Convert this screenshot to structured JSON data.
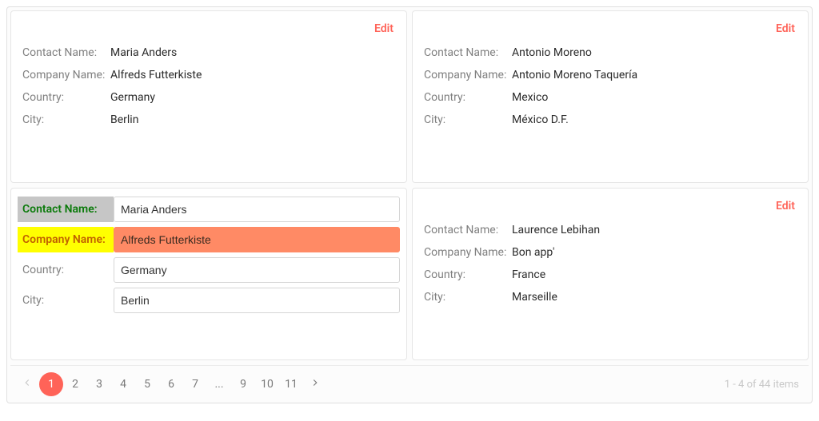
{
  "labels": {
    "edit": "Edit",
    "contactName": "Contact Name:",
    "companyName": "Company Name:",
    "country": "Country:",
    "city": "City:"
  },
  "cards": [
    {
      "contactName": "Maria Anders",
      "companyName": "Alfreds Futterkiste",
      "country": "Germany",
      "city": "Berlin"
    },
    {
      "contactName": "Antonio Moreno",
      "companyName": "Antonio Moreno Taquería",
      "country": "Mexico",
      "city": "México D.F."
    },
    {
      "contactName": "Maria Anders",
      "companyName": "Alfreds Futterkiste",
      "country": "Germany",
      "city": "Berlin"
    },
    {
      "contactName": "Laurence Lebihan",
      "companyName": "Bon app'",
      "country": "France",
      "city": "Marseille"
    }
  ],
  "pager": {
    "pages": [
      "1",
      "2",
      "3",
      "4",
      "5",
      "6",
      "7",
      "...",
      "9",
      "10",
      "11"
    ],
    "current": 0,
    "info": "1 - 4 of 44 items"
  }
}
